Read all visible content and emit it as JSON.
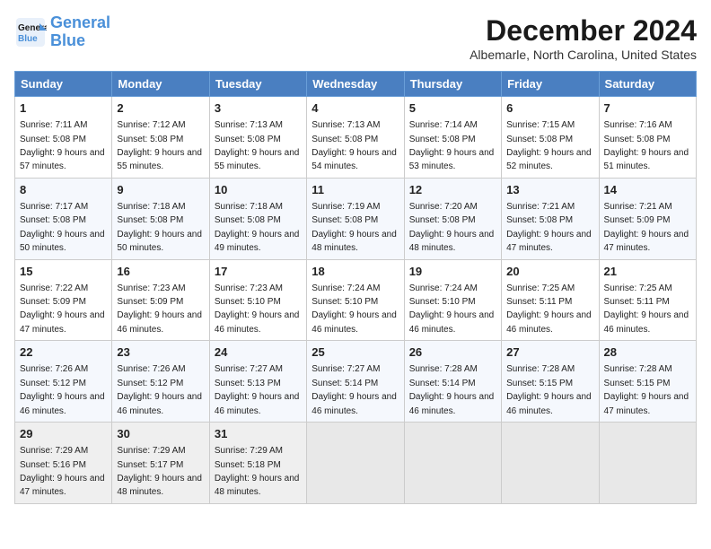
{
  "header": {
    "logo_line1": "General",
    "logo_line2": "Blue",
    "month_title": "December 2024",
    "location": "Albemarle, North Carolina, United States"
  },
  "days_of_week": [
    "Sunday",
    "Monday",
    "Tuesday",
    "Wednesday",
    "Thursday",
    "Friday",
    "Saturday"
  ],
  "weeks": [
    [
      {
        "day": "1",
        "sunrise": "7:11 AM",
        "sunset": "5:08 PM",
        "daylight": "9 hours and 57 minutes."
      },
      {
        "day": "2",
        "sunrise": "7:12 AM",
        "sunset": "5:08 PM",
        "daylight": "9 hours and 55 minutes."
      },
      {
        "day": "3",
        "sunrise": "7:13 AM",
        "sunset": "5:08 PM",
        "daylight": "9 hours and 55 minutes."
      },
      {
        "day": "4",
        "sunrise": "7:13 AM",
        "sunset": "5:08 PM",
        "daylight": "9 hours and 54 minutes."
      },
      {
        "day": "5",
        "sunrise": "7:14 AM",
        "sunset": "5:08 PM",
        "daylight": "9 hours and 53 minutes."
      },
      {
        "day": "6",
        "sunrise": "7:15 AM",
        "sunset": "5:08 PM",
        "daylight": "9 hours and 52 minutes."
      },
      {
        "day": "7",
        "sunrise": "7:16 AM",
        "sunset": "5:08 PM",
        "daylight": "9 hours and 51 minutes."
      }
    ],
    [
      {
        "day": "8",
        "sunrise": "7:17 AM",
        "sunset": "5:08 PM",
        "daylight": "9 hours and 50 minutes."
      },
      {
        "day": "9",
        "sunrise": "7:18 AM",
        "sunset": "5:08 PM",
        "daylight": "9 hours and 50 minutes."
      },
      {
        "day": "10",
        "sunrise": "7:18 AM",
        "sunset": "5:08 PM",
        "daylight": "9 hours and 49 minutes."
      },
      {
        "day": "11",
        "sunrise": "7:19 AM",
        "sunset": "5:08 PM",
        "daylight": "9 hours and 48 minutes."
      },
      {
        "day": "12",
        "sunrise": "7:20 AM",
        "sunset": "5:08 PM",
        "daylight": "9 hours and 48 minutes."
      },
      {
        "day": "13",
        "sunrise": "7:21 AM",
        "sunset": "5:08 PM",
        "daylight": "9 hours and 47 minutes."
      },
      {
        "day": "14",
        "sunrise": "7:21 AM",
        "sunset": "5:09 PM",
        "daylight": "9 hours and 47 minutes."
      }
    ],
    [
      {
        "day": "15",
        "sunrise": "7:22 AM",
        "sunset": "5:09 PM",
        "daylight": "9 hours and 47 minutes."
      },
      {
        "day": "16",
        "sunrise": "7:23 AM",
        "sunset": "5:09 PM",
        "daylight": "9 hours and 46 minutes."
      },
      {
        "day": "17",
        "sunrise": "7:23 AM",
        "sunset": "5:10 PM",
        "daylight": "9 hours and 46 minutes."
      },
      {
        "day": "18",
        "sunrise": "7:24 AM",
        "sunset": "5:10 PM",
        "daylight": "9 hours and 46 minutes."
      },
      {
        "day": "19",
        "sunrise": "7:24 AM",
        "sunset": "5:10 PM",
        "daylight": "9 hours and 46 minutes."
      },
      {
        "day": "20",
        "sunrise": "7:25 AM",
        "sunset": "5:11 PM",
        "daylight": "9 hours and 46 minutes."
      },
      {
        "day": "21",
        "sunrise": "7:25 AM",
        "sunset": "5:11 PM",
        "daylight": "9 hours and 46 minutes."
      }
    ],
    [
      {
        "day": "22",
        "sunrise": "7:26 AM",
        "sunset": "5:12 PM",
        "daylight": "9 hours and 46 minutes."
      },
      {
        "day": "23",
        "sunrise": "7:26 AM",
        "sunset": "5:12 PM",
        "daylight": "9 hours and 46 minutes."
      },
      {
        "day": "24",
        "sunrise": "7:27 AM",
        "sunset": "5:13 PM",
        "daylight": "9 hours and 46 minutes."
      },
      {
        "day": "25",
        "sunrise": "7:27 AM",
        "sunset": "5:14 PM",
        "daylight": "9 hours and 46 minutes."
      },
      {
        "day": "26",
        "sunrise": "7:28 AM",
        "sunset": "5:14 PM",
        "daylight": "9 hours and 46 minutes."
      },
      {
        "day": "27",
        "sunrise": "7:28 AM",
        "sunset": "5:15 PM",
        "daylight": "9 hours and 46 minutes."
      },
      {
        "day": "28",
        "sunrise": "7:28 AM",
        "sunset": "5:15 PM",
        "daylight": "9 hours and 47 minutes."
      }
    ],
    [
      {
        "day": "29",
        "sunrise": "7:29 AM",
        "sunset": "5:16 PM",
        "daylight": "9 hours and 47 minutes."
      },
      {
        "day": "30",
        "sunrise": "7:29 AM",
        "sunset": "5:17 PM",
        "daylight": "9 hours and 48 minutes."
      },
      {
        "day": "31",
        "sunrise": "7:29 AM",
        "sunset": "5:18 PM",
        "daylight": "9 hours and 48 minutes."
      },
      null,
      null,
      null,
      null
    ]
  ]
}
